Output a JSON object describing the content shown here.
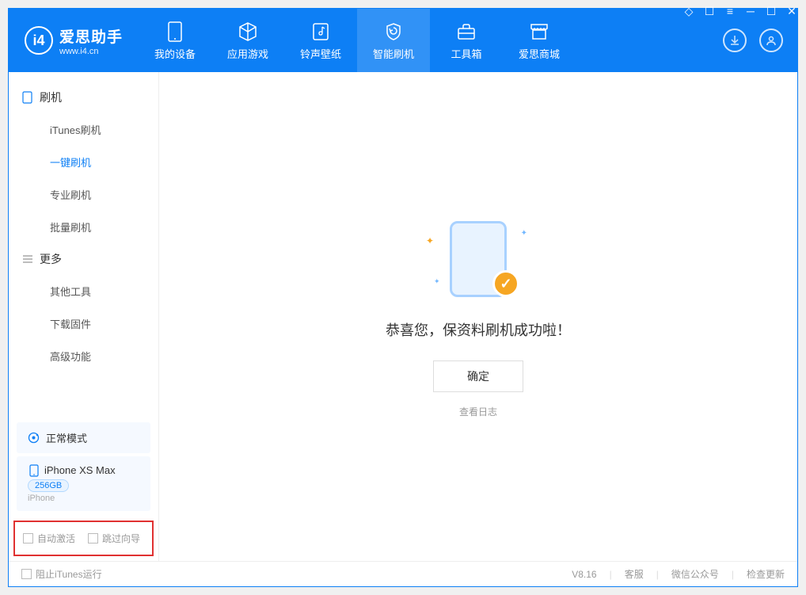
{
  "app": {
    "title": "爱思助手",
    "subtitle": "www.i4.cn"
  },
  "nav": {
    "tabs": [
      {
        "label": "我的设备"
      },
      {
        "label": "应用游戏"
      },
      {
        "label": "铃声壁纸"
      },
      {
        "label": "智能刷机"
      },
      {
        "label": "工具箱"
      },
      {
        "label": "爱思商城"
      }
    ]
  },
  "sidebar": {
    "group1_title": "刷机",
    "group1_items": [
      "iTunes刷机",
      "一键刷机",
      "专业刷机",
      "批量刷机"
    ],
    "group2_title": "更多",
    "group2_items": [
      "其他工具",
      "下载固件",
      "高级功能"
    ]
  },
  "device": {
    "mode": "正常模式",
    "name": "iPhone XS Max",
    "capacity": "256GB",
    "type": "iPhone"
  },
  "options": {
    "auto_activate": "自动激活",
    "skip_guide": "跳过向导"
  },
  "main": {
    "success_msg": "恭喜您，保资料刷机成功啦！",
    "ok_btn": "确定",
    "view_log": "查看日志"
  },
  "statusbar": {
    "block_itunes": "阻止iTunes运行",
    "version": "V8.16",
    "links": [
      "客服",
      "微信公众号",
      "检查更新"
    ]
  }
}
